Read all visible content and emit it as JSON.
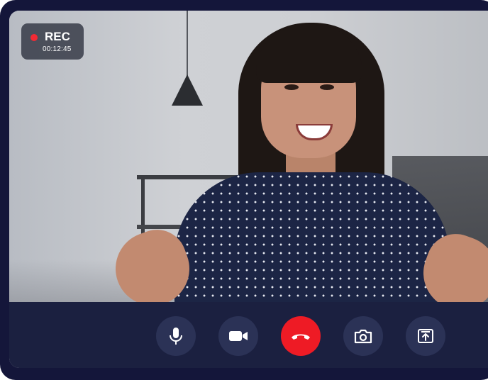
{
  "recording": {
    "label": "REC",
    "elapsed": "00:12:45",
    "indicator_color": "#f22a34"
  },
  "controls": [
    {
      "name": "microphone",
      "icon": "microphone-icon"
    },
    {
      "name": "camera",
      "icon": "video-camera-icon"
    },
    {
      "name": "end-call",
      "icon": "phone-hangup-icon",
      "color": "#ee1b25"
    },
    {
      "name": "snapshot",
      "icon": "photo-camera-icon"
    },
    {
      "name": "share-screen",
      "icon": "share-screen-icon"
    }
  ],
  "colors": {
    "frame": "#14163a",
    "control_bar": "#1b2040",
    "control_button": "#2b3256",
    "hangup": "#ee1b25"
  }
}
